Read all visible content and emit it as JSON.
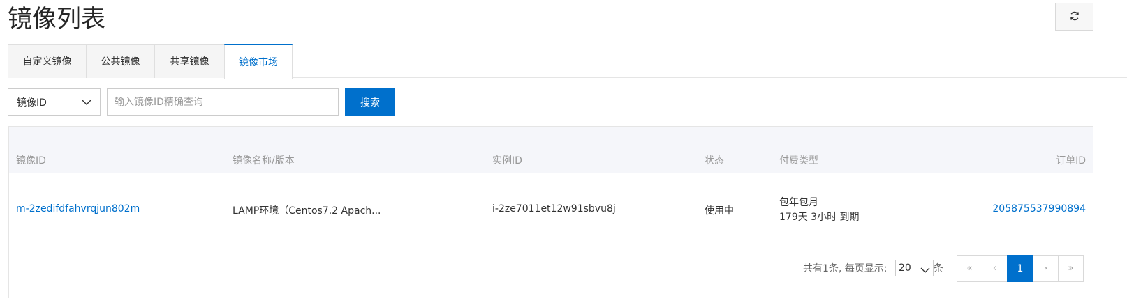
{
  "page": {
    "title": "镜像列表"
  },
  "toolbar": {
    "refresh_icon": "refresh-icon"
  },
  "tabs": [
    {
      "label": "自定义镜像",
      "active": false
    },
    {
      "label": "公共镜像",
      "active": false
    },
    {
      "label": "共享镜像",
      "active": false
    },
    {
      "label": "镜像市场",
      "active": true
    }
  ],
  "filter": {
    "select_value": "镜像ID",
    "search_placeholder": "输入镜像ID精确查询",
    "search_value": "",
    "search_button": "搜索"
  },
  "table": {
    "columns": [
      "镜像ID",
      "镜像名称/版本",
      "实例ID",
      "状态",
      "付费类型",
      "订单ID"
    ],
    "rows": [
      {
        "image_id": "m-2zedifdfahvrqjun802m",
        "image_name": "LAMP环境（Centos7.2 Apach...",
        "instance_id": "i-2ze7011et12w91sbvu8j",
        "status": "使用中",
        "billing_type": "包年包月",
        "expire": "179天 3小时 到期",
        "order_id": "205875537990894"
      }
    ]
  },
  "pagination": {
    "total_text": "共有1条, 每页显示:",
    "page_size": "20",
    "unit": "条",
    "first": "«",
    "prev": "‹",
    "current": "1",
    "next": "›",
    "last": "»"
  },
  "colors": {
    "accent": "#0070cc",
    "header_bg": "#f5f6fa"
  }
}
